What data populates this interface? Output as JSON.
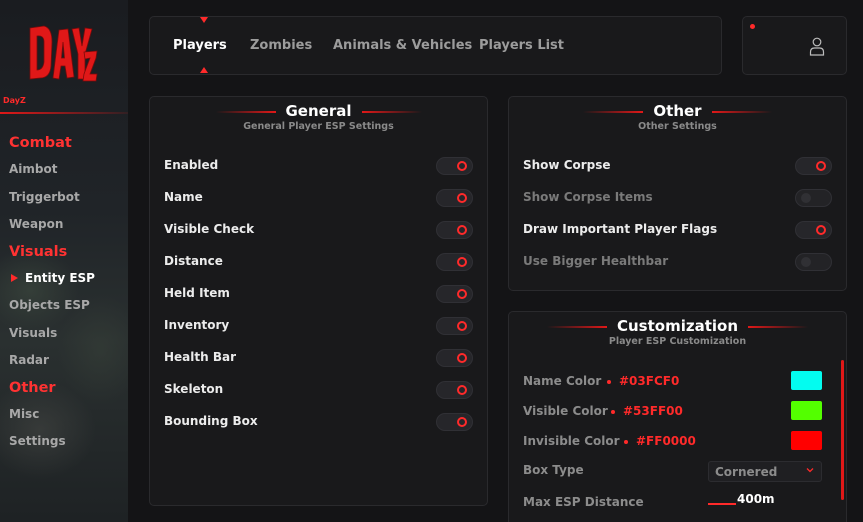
{
  "brand": {
    "logo_text": "DAYZ",
    "subtitle": "DayZ"
  },
  "sidebar": {
    "sections": [
      {
        "title": "Combat",
        "items": [
          "Aimbot",
          "Triggerbot",
          "Weapon"
        ]
      },
      {
        "title": "Visuals",
        "items": [
          "Entity ESP",
          "Objects ESP",
          "Visuals",
          "Radar"
        ]
      },
      {
        "title": "Other",
        "items": [
          "Misc",
          "Settings"
        ]
      }
    ],
    "active_item": "Entity ESP"
  },
  "tabs": [
    "Players",
    "Zombies",
    "Animals & Vehicles",
    "Players List"
  ],
  "active_tab": "Players",
  "general": {
    "title": "General",
    "subtitle": "General Player ESP Settings",
    "options": [
      {
        "label": "Enabled",
        "on": true
      },
      {
        "label": "Name",
        "on": true
      },
      {
        "label": "Visible Check",
        "on": true
      },
      {
        "label": "Distance",
        "on": true
      },
      {
        "label": "Held Item",
        "on": true
      },
      {
        "label": "Inventory",
        "on": true
      },
      {
        "label": "Health Bar",
        "on": true
      },
      {
        "label": "Skeleton",
        "on": true
      },
      {
        "label": "Bounding Box",
        "on": true
      }
    ]
  },
  "other": {
    "title": "Other",
    "subtitle": "Other Settings",
    "options": [
      {
        "label": "Show Corpse",
        "on": true
      },
      {
        "label": "Show Corpse Items",
        "on": false
      },
      {
        "label": "Draw Important Player Flags",
        "on": true
      },
      {
        "label": "Use Bigger Healthbar",
        "on": false
      }
    ]
  },
  "customization": {
    "title": "Customization",
    "subtitle": "Player ESP Customization",
    "colors": [
      {
        "label": "Name Color",
        "hex": "#03FCF0",
        "swatch": "#03FCF0"
      },
      {
        "label": "Visible Color",
        "hex": "#53FF00",
        "swatch": "#53FF00"
      },
      {
        "label": "Invisible Color",
        "hex": "#FF0000",
        "swatch": "#FF0000"
      }
    ],
    "box_type": {
      "label": "Box Type",
      "value": "Cornered"
    },
    "max_distance": {
      "label": "Max ESP Distance",
      "value": "400m"
    }
  },
  "theme": {
    "accent": "#FF2A2A",
    "background": "#141416",
    "panel": "#19191B"
  }
}
